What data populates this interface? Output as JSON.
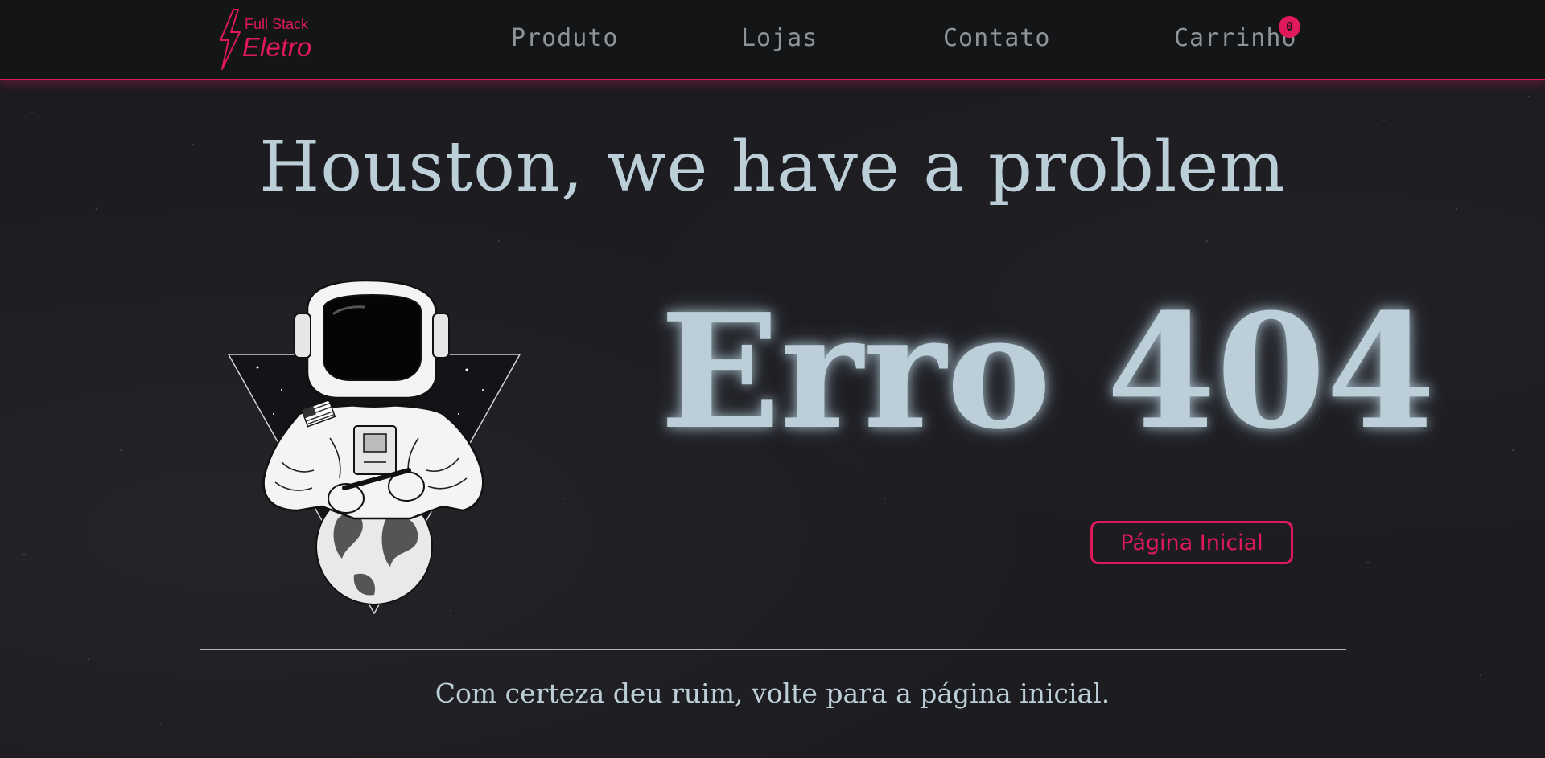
{
  "brand": {
    "line1": "Full Stack",
    "line2": "Eletro",
    "accent_color": "#e0195a"
  },
  "nav": {
    "items": [
      {
        "label": "Produto"
      },
      {
        "label": "Lojas"
      },
      {
        "label": "Contato"
      },
      {
        "label": "Carrinho"
      }
    ],
    "cart_count": "0"
  },
  "main": {
    "headline": "Houston, we have a problem",
    "error_code": "Erro 404",
    "home_button_label": "Página Inicial",
    "message": "Com certeza deu ruim, volte para a página inicial.",
    "illustration_icon": "astronaut-icon",
    "text_color": "#bccfd8"
  }
}
